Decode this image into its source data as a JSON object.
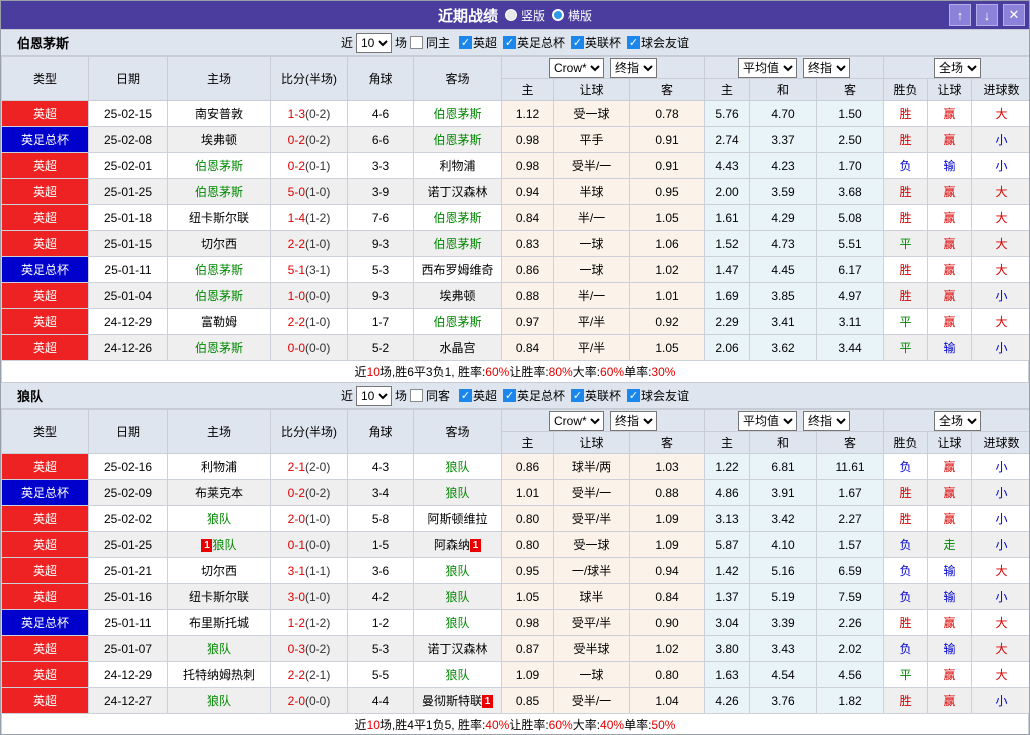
{
  "colors": {
    "titlebar": "#4a3d9e",
    "league_red": "#ee2222",
    "league_blue": "#0000cc",
    "focus_green": "#008800",
    "score_red": "#e00000",
    "win_red": "#dd0000",
    "lose_blue": "#0000cc",
    "draw_green": "#008800",
    "odds_bg1": "#fbf3ea",
    "odds_bg2": "#e9f4f9",
    "header_bg": "#dfe5ee",
    "checkbox_blue": "#1b87ec"
  },
  "titlebar": {
    "title": "近期战绩",
    "radio_vertical": "竖版",
    "radio_horizontal": "横版",
    "btn_up": "↑",
    "btn_down": "↓",
    "btn_close": "✕"
  },
  "table_header": {
    "cols": [
      "类型",
      "日期",
      "主场",
      "比分(半场)",
      "角球",
      "客场"
    ],
    "selects": [
      "Crow*",
      "终指",
      "平均值",
      "终指",
      "全场"
    ],
    "sub": [
      "主",
      "让球",
      "客",
      "主",
      "和",
      "客",
      "胜负",
      "让球",
      "进球数"
    ]
  },
  "sections": [
    {
      "team": "伯恩茅斯",
      "filter": {
        "near": "近",
        "count": "10",
        "matches": "场",
        "same": "同主",
        "leagues": [
          "英超",
          "英足总杯",
          "英联杯",
          "球会友谊"
        ]
      },
      "rows": [
        {
          "lg": "英超",
          "lgc": "red",
          "date": "25-02-15",
          "home": "南安普敦",
          "hf": false,
          "hc": false,
          "score": "1-3",
          "half": "(0-2)",
          "cn": "4-6",
          "away": "伯恩茅斯",
          "af": true,
          "ac": false,
          "o1": [
            "1.12",
            "受一球",
            "0.78"
          ],
          "o2": [
            "5.76",
            "4.70",
            "1.50"
          ],
          "r": [
            [
              "胜",
              "r"
            ],
            [
              "赢",
              "r"
            ],
            [
              "大",
              "r"
            ]
          ]
        },
        {
          "lg": "英足总杯",
          "lgc": "blue",
          "date": "25-02-08",
          "home": "埃弗顿",
          "hf": false,
          "hc": false,
          "score": "0-2",
          "half": "(0-2)",
          "cn": "6-6",
          "away": "伯恩茅斯",
          "af": true,
          "ac": false,
          "o1": [
            "0.98",
            "平手",
            "0.91"
          ],
          "o2": [
            "2.74",
            "3.37",
            "2.50"
          ],
          "r": [
            [
              "胜",
              "r"
            ],
            [
              "赢",
              "r"
            ],
            [
              "小",
              "b"
            ]
          ]
        },
        {
          "lg": "英超",
          "lgc": "red",
          "date": "25-02-01",
          "home": "伯恩茅斯",
          "hf": true,
          "hc": false,
          "score": "0-2",
          "half": "(0-1)",
          "cn": "3-3",
          "away": "利物浦",
          "af": false,
          "ac": false,
          "o1": [
            "0.98",
            "受半/一",
            "0.91"
          ],
          "o2": [
            "4.43",
            "4.23",
            "1.70"
          ],
          "r": [
            [
              "负",
              "b"
            ],
            [
              "输",
              "b"
            ],
            [
              "小",
              "b"
            ]
          ]
        },
        {
          "lg": "英超",
          "lgc": "red",
          "date": "25-01-25",
          "home": "伯恩茅斯",
          "hf": true,
          "hc": false,
          "score": "5-0",
          "half": "(1-0)",
          "cn": "3-9",
          "away": "诺丁汉森林",
          "af": false,
          "ac": false,
          "o1": [
            "0.94",
            "半球",
            "0.95"
          ],
          "o2": [
            "2.00",
            "3.59",
            "3.68"
          ],
          "r": [
            [
              "胜",
              "r"
            ],
            [
              "赢",
              "r"
            ],
            [
              "大",
              "r"
            ]
          ]
        },
        {
          "lg": "英超",
          "lgc": "red",
          "date": "25-01-18",
          "home": "纽卡斯尔联",
          "hf": false,
          "hc": false,
          "score": "1-4",
          "half": "(1-2)",
          "cn": "7-6",
          "away": "伯恩茅斯",
          "af": true,
          "ac": false,
          "o1": [
            "0.84",
            "半/一",
            "1.05"
          ],
          "o2": [
            "1.61",
            "4.29",
            "5.08"
          ],
          "r": [
            [
              "胜",
              "r"
            ],
            [
              "赢",
              "r"
            ],
            [
              "大",
              "r"
            ]
          ]
        },
        {
          "lg": "英超",
          "lgc": "red",
          "date": "25-01-15",
          "home": "切尔西",
          "hf": false,
          "hc": false,
          "score": "2-2",
          "half": "(1-0)",
          "cn": "9-3",
          "away": "伯恩茅斯",
          "af": true,
          "ac": false,
          "o1": [
            "0.83",
            "一球",
            "1.06"
          ],
          "o2": [
            "1.52",
            "4.73",
            "5.51"
          ],
          "r": [
            [
              "平",
              "g"
            ],
            [
              "赢",
              "r"
            ],
            [
              "大",
              "r"
            ]
          ]
        },
        {
          "lg": "英足总杯",
          "lgc": "blue",
          "date": "25-01-11",
          "home": "伯恩茅斯",
          "hf": true,
          "hc": false,
          "score": "5-1",
          "half": "(3-1)",
          "cn": "5-3",
          "away": "西布罗姆维奇",
          "af": false,
          "ac": false,
          "o1": [
            "0.86",
            "一球",
            "1.02"
          ],
          "o2": [
            "1.47",
            "4.45",
            "6.17"
          ],
          "r": [
            [
              "胜",
              "r"
            ],
            [
              "赢",
              "r"
            ],
            [
              "大",
              "r"
            ]
          ]
        },
        {
          "lg": "英超",
          "lgc": "red",
          "date": "25-01-04",
          "home": "伯恩茅斯",
          "hf": true,
          "hc": false,
          "score": "1-0",
          "half": "(0-0)",
          "cn": "9-3",
          "away": "埃弗顿",
          "af": false,
          "ac": false,
          "o1": [
            "0.88",
            "半/一",
            "1.01"
          ],
          "o2": [
            "1.69",
            "3.85",
            "4.97"
          ],
          "r": [
            [
              "胜",
              "r"
            ],
            [
              "赢",
              "r"
            ],
            [
              "小",
              "b"
            ]
          ]
        },
        {
          "lg": "英超",
          "lgc": "red",
          "date": "24-12-29",
          "home": "富勒姆",
          "hf": false,
          "hc": false,
          "score": "2-2",
          "half": "(1-0)",
          "cn": "1-7",
          "away": "伯恩茅斯",
          "af": true,
          "ac": false,
          "o1": [
            "0.97",
            "平/半",
            "0.92"
          ],
          "o2": [
            "2.29",
            "3.41",
            "3.11"
          ],
          "r": [
            [
              "平",
              "g"
            ],
            [
              "赢",
              "r"
            ],
            [
              "大",
              "r"
            ]
          ]
        },
        {
          "lg": "英超",
          "lgc": "red",
          "date": "24-12-26",
          "home": "伯恩茅斯",
          "hf": true,
          "hc": false,
          "score": "0-0",
          "half": "(0-0)",
          "cn": "5-2",
          "away": "水晶宫",
          "af": false,
          "ac": false,
          "o1": [
            "0.84",
            "平/半",
            "1.05"
          ],
          "o2": [
            "2.06",
            "3.62",
            "3.44"
          ],
          "r": [
            [
              "平",
              "g"
            ],
            [
              "输",
              "b"
            ],
            [
              "小",
              "b"
            ]
          ]
        }
      ],
      "summary": [
        [
          "近",
          "k"
        ],
        [
          "10",
          "r"
        ],
        [
          "场,胜6平3负1, 胜率:",
          "k"
        ],
        [
          "60%",
          "r"
        ],
        [
          " 让胜率:",
          "k"
        ],
        [
          "80%",
          "r"
        ],
        [
          " 大率:",
          "k"
        ],
        [
          "60%",
          "r"
        ],
        [
          " 单率:",
          "k"
        ],
        [
          "30%",
          "r"
        ]
      ]
    },
    {
      "team": "狼队",
      "filter": {
        "near": "近",
        "count": "10",
        "matches": "场",
        "same": "同客",
        "leagues": [
          "英超",
          "英足总杯",
          "英联杯",
          "球会友谊"
        ]
      },
      "rows": [
        {
          "lg": "英超",
          "lgc": "red",
          "date": "25-02-16",
          "home": "利物浦",
          "hf": false,
          "hc": false,
          "score": "2-1",
          "half": "(2-0)",
          "cn": "4-3",
          "away": "狼队",
          "af": true,
          "ac": false,
          "o1": [
            "0.86",
            "球半/两",
            "1.03"
          ],
          "o2": [
            "1.22",
            "6.81",
            "11.61"
          ],
          "r": [
            [
              "负",
              "b"
            ],
            [
              "赢",
              "r"
            ],
            [
              "小",
              "b"
            ]
          ]
        },
        {
          "lg": "英足总杯",
          "lgc": "blue",
          "date": "25-02-09",
          "home": "布莱克本",
          "hf": false,
          "hc": false,
          "score": "0-2",
          "half": "(0-2)",
          "cn": "3-4",
          "away": "狼队",
          "af": true,
          "ac": false,
          "o1": [
            "1.01",
            "受半/一",
            "0.88"
          ],
          "o2": [
            "4.86",
            "3.91",
            "1.67"
          ],
          "r": [
            [
              "胜",
              "r"
            ],
            [
              "赢",
              "r"
            ],
            [
              "小",
              "b"
            ]
          ]
        },
        {
          "lg": "英超",
          "lgc": "red",
          "date": "25-02-02",
          "home": "狼队",
          "hf": true,
          "hc": false,
          "score": "2-0",
          "half": "(1-0)",
          "cn": "5-8",
          "away": "阿斯顿维拉",
          "af": false,
          "ac": false,
          "o1": [
            "0.80",
            "受平/半",
            "1.09"
          ],
          "o2": [
            "3.13",
            "3.42",
            "2.27"
          ],
          "r": [
            [
              "胜",
              "r"
            ],
            [
              "赢",
              "r"
            ],
            [
              "小",
              "b"
            ]
          ]
        },
        {
          "lg": "英超",
          "lgc": "red",
          "date": "25-01-25",
          "home": "狼队",
          "hf": true,
          "hc": true,
          "score": "0-1",
          "half": "(0-0)",
          "cn": "1-5",
          "away": "阿森纳",
          "af": false,
          "ac": true,
          "o1": [
            "0.80",
            "受一球",
            "1.09"
          ],
          "o2": [
            "5.87",
            "4.10",
            "1.57"
          ],
          "r": [
            [
              "负",
              "b"
            ],
            [
              "走",
              "g"
            ],
            [
              "小",
              "b"
            ]
          ]
        },
        {
          "lg": "英超",
          "lgc": "red",
          "date": "25-01-21",
          "home": "切尔西",
          "hf": false,
          "hc": false,
          "score": "3-1",
          "half": "(1-1)",
          "cn": "3-6",
          "away": "狼队",
          "af": true,
          "ac": false,
          "o1": [
            "0.95",
            "一/球半",
            "0.94"
          ],
          "o2": [
            "1.42",
            "5.16",
            "6.59"
          ],
          "r": [
            [
              "负",
              "b"
            ],
            [
              "输",
              "b"
            ],
            [
              "大",
              "r"
            ]
          ]
        },
        {
          "lg": "英超",
          "lgc": "red",
          "date": "25-01-16",
          "home": "纽卡斯尔联",
          "hf": false,
          "hc": false,
          "score": "3-0",
          "half": "(1-0)",
          "cn": "4-2",
          "away": "狼队",
          "af": true,
          "ac": false,
          "o1": [
            "1.05",
            "球半",
            "0.84"
          ],
          "o2": [
            "1.37",
            "5.19",
            "7.59"
          ],
          "r": [
            [
              "负",
              "b"
            ],
            [
              "输",
              "b"
            ],
            [
              "小",
              "b"
            ]
          ]
        },
        {
          "lg": "英足总杯",
          "lgc": "blue",
          "date": "25-01-11",
          "home": "布里斯托城",
          "hf": false,
          "hc": false,
          "score": "1-2",
          "half": "(1-2)",
          "cn": "1-2",
          "away": "狼队",
          "af": true,
          "ac": false,
          "o1": [
            "0.98",
            "受平/半",
            "0.90"
          ],
          "o2": [
            "3.04",
            "3.39",
            "2.26"
          ],
          "r": [
            [
              "胜",
              "r"
            ],
            [
              "赢",
              "r"
            ],
            [
              "大",
              "r"
            ]
          ]
        },
        {
          "lg": "英超",
          "lgc": "red",
          "date": "25-01-07",
          "home": "狼队",
          "hf": true,
          "hc": false,
          "score": "0-3",
          "half": "(0-2)",
          "cn": "5-3",
          "away": "诺丁汉森林",
          "af": false,
          "ac": false,
          "o1": [
            "0.87",
            "受半球",
            "1.02"
          ],
          "o2": [
            "3.80",
            "3.43",
            "2.02"
          ],
          "r": [
            [
              "负",
              "b"
            ],
            [
              "输",
              "b"
            ],
            [
              "大",
              "r"
            ]
          ]
        },
        {
          "lg": "英超",
          "lgc": "red",
          "date": "24-12-29",
          "home": "托特纳姆热刺",
          "hf": false,
          "hc": false,
          "score": "2-2",
          "half": "(2-1)",
          "cn": "5-5",
          "away": "狼队",
          "af": true,
          "ac": false,
          "o1": [
            "1.09",
            "一球",
            "0.80"
          ],
          "o2": [
            "1.63",
            "4.54",
            "4.56"
          ],
          "r": [
            [
              "平",
              "g"
            ],
            [
              "赢",
              "r"
            ],
            [
              "大",
              "r"
            ]
          ]
        },
        {
          "lg": "英超",
          "lgc": "red",
          "date": "24-12-27",
          "home": "狼队",
          "hf": true,
          "hc": false,
          "score": "2-0",
          "half": "(0-0)",
          "cn": "4-4",
          "away": "曼彻斯特联",
          "af": false,
          "ac": true,
          "o1": [
            "0.85",
            "受半/一",
            "1.04"
          ],
          "o2": [
            "4.26",
            "3.76",
            "1.82"
          ],
          "r": [
            [
              "胜",
              "r"
            ],
            [
              "赢",
              "r"
            ],
            [
              "小",
              "b"
            ]
          ]
        }
      ],
      "summary": [
        [
          "近",
          "k"
        ],
        [
          "10",
          "r"
        ],
        [
          "场,胜4平1负5, 胜率:",
          "k"
        ],
        [
          "40%",
          "r"
        ],
        [
          " 让胜率:",
          "k"
        ],
        [
          "60%",
          "r"
        ],
        [
          " 大率:",
          "k"
        ],
        [
          "40%",
          "r"
        ],
        [
          " 单率:",
          "k"
        ],
        [
          "50%",
          "r"
        ]
      ]
    }
  ]
}
